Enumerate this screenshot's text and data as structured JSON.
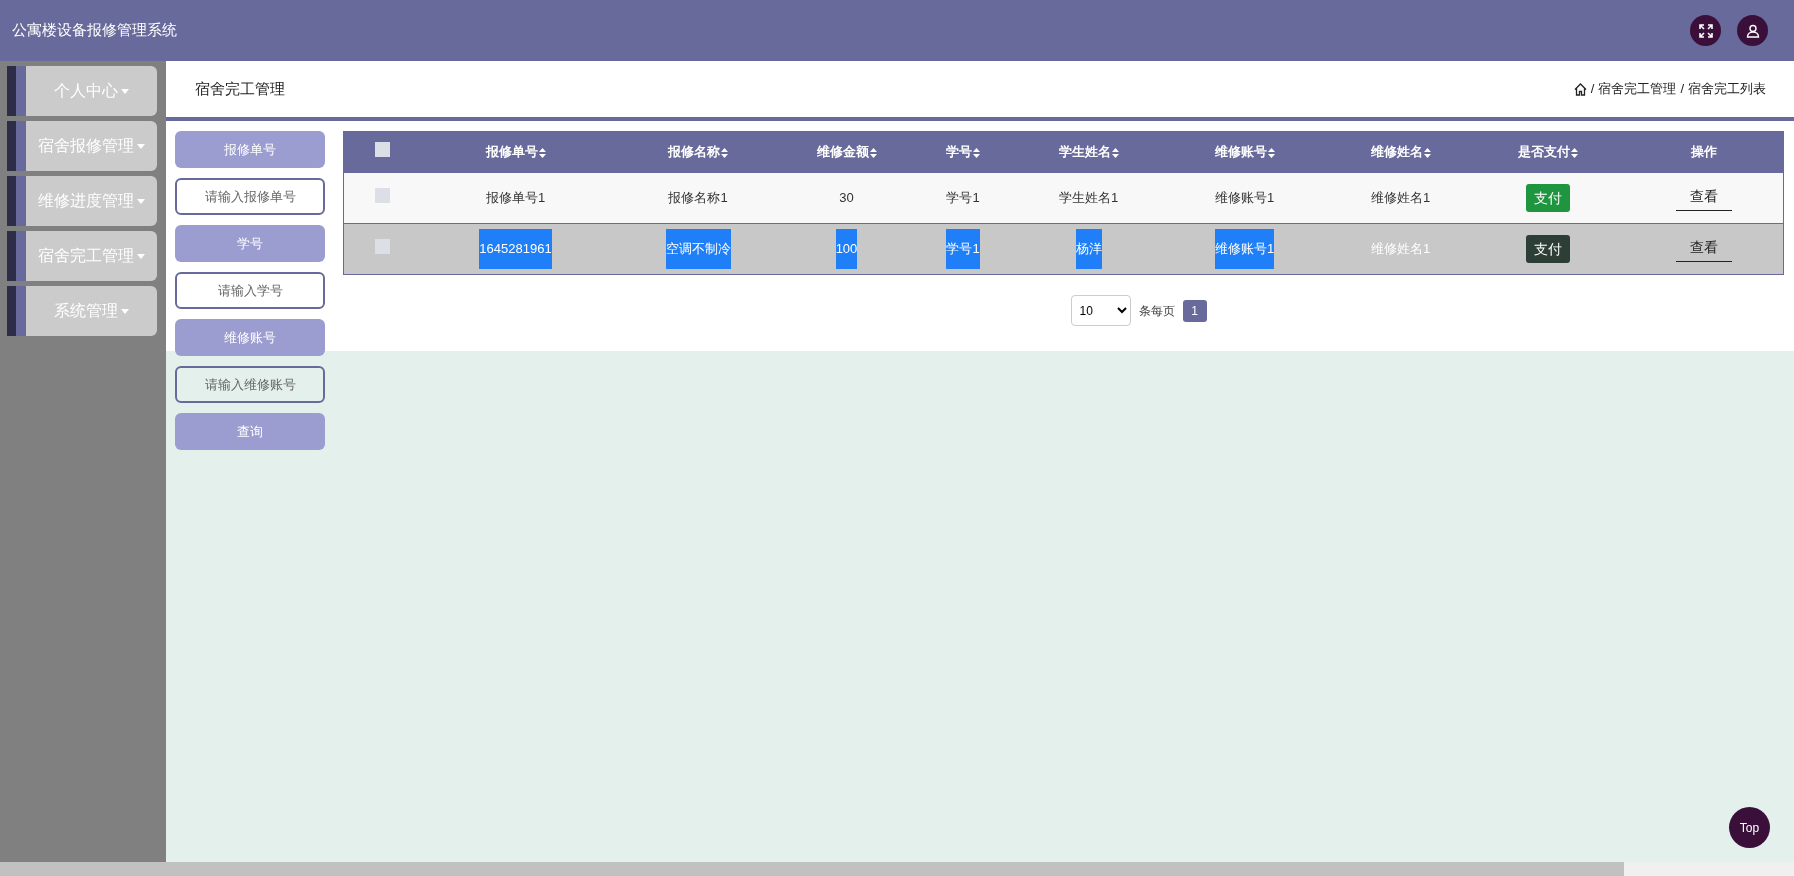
{
  "header": {
    "title": "公寓楼设备报修管理系统"
  },
  "sidebar": {
    "items": [
      {
        "label": "个人中心"
      },
      {
        "label": "宿舍报修管理"
      },
      {
        "label": "维修进度管理"
      },
      {
        "label": "宿舍完工管理"
      },
      {
        "label": "系统管理"
      }
    ]
  },
  "page_title": "宿舍完工管理",
  "breadcrumb": [
    {
      "kind": "home"
    },
    {
      "kind": "separator",
      "text": "/"
    },
    {
      "kind": "link",
      "text": "宿舍完工管理"
    },
    {
      "kind": "separator",
      "text": "/"
    },
    {
      "kind": "link",
      "text": "宿舍完工列表"
    }
  ],
  "search": {
    "fields": [
      {
        "label": "报修单号",
        "placeholder": "请输入报修单号"
      },
      {
        "label": "学号",
        "placeholder": "请输入学号"
      },
      {
        "label": "维修账号",
        "placeholder": "请输入维修账号"
      }
    ],
    "button": "查询"
  },
  "table": {
    "header_checked": false,
    "columns": [
      {
        "label": "报修单号",
        "sortable": true
      },
      {
        "label": "报修名称",
        "sortable": true
      },
      {
        "label": "维修金额",
        "sortable": true
      },
      {
        "label": "学号",
        "sortable": true
      },
      {
        "label": "学生姓名",
        "sortable": true
      },
      {
        "label": "维修账号",
        "sortable": true
      },
      {
        "label": "维修姓名",
        "sortable": true
      },
      {
        "label": "是否支付",
        "sortable": true
      },
      {
        "label": "操作",
        "sortable": false
      }
    ],
    "rows": [
      {
        "checked": false,
        "hovered": false,
        "cells": [
          {
            "text": "报修单号1",
            "text_selected": false
          },
          {
            "text": "报修名称1",
            "text_selected": false
          },
          {
            "text": "30",
            "text_selected": false
          },
          {
            "text": "学号1",
            "text_selected": false
          },
          {
            "text": "学生姓名1",
            "text_selected": false
          },
          {
            "text": "维修账号1",
            "text_selected": false
          },
          {
            "text": "维修姓名1",
            "text_selected": false
          }
        ],
        "pay": {
          "label": "支付",
          "hovered": false
        },
        "view": "查看"
      },
      {
        "checked": false,
        "hovered": true,
        "cells": [
          {
            "text": "1645281961",
            "text_selected": true
          },
          {
            "text": "空调不制冷",
            "text_selected": true
          },
          {
            "text": "100",
            "text_selected": true
          },
          {
            "text": "学号1",
            "text_selected": true
          },
          {
            "text": "杨洋",
            "text_selected": true
          },
          {
            "text": "维修账号1",
            "text_selected": true
          },
          {
            "text": "维修姓名1",
            "text_selected": false
          }
        ],
        "pay": {
          "label": "支付",
          "hovered": true
        },
        "view": "查看"
      }
    ]
  },
  "pagination": {
    "page_size": "10",
    "page_size_label": "条每页",
    "pages": [
      {
        "label": "1",
        "selected": true
      }
    ]
  },
  "back_to_top": "Top"
}
